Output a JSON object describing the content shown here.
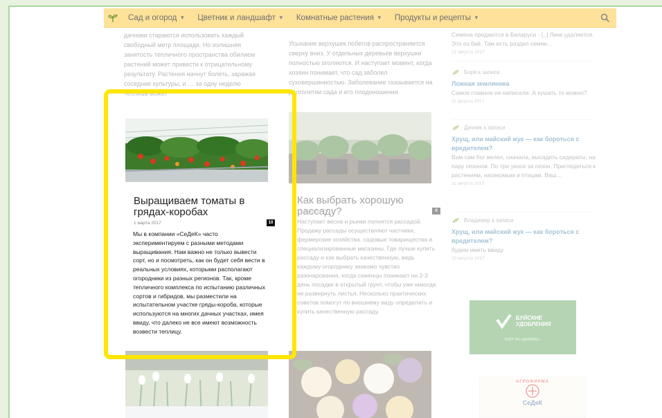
{
  "nav": {
    "items": [
      {
        "label": "Сад и огород"
      },
      {
        "label": "Цветник и ландшафт"
      },
      {
        "label": "Комнатные растения"
      },
      {
        "label": "Продукты и рецепты"
      }
    ]
  },
  "top_left": {
    "text": "дачники стараются использовать каждый свободный метр площади. Но излишняя занятость тепличного пространства обилием растений может привести к отрицательному результату. Растения начнут болеть, заражая соседние культуры, и … за одну неделю теплица может"
  },
  "top_mid": {
    "text": "Усыхание верхушек побегов распространяется сверху вниз. У отдельных деревьев верхушки полностью оголяются. И наступает момент, когда хозяин понимает, что сад заболел суховершинностью. Заболевание сказывается на долголетии сада и его плодоношении."
  },
  "post1": {
    "title": "Выращиваем томаты в грядах-коробах",
    "date": "1 марта 2017",
    "comments": "10",
    "text": "Мы в компании «СеДеК» часто экспериментируем с разными методами выращивания. Нам важно не только вывести сорт, но и посмотреть, как он будет себя вести в реальных условиях, которыми располагают огородники из разных регионов. Так, кроме тепличного комплекса по испытанию различных сортов и гибридов, мы разместили на испытательном участке гряды-короба, которые используются на многих дачных участках, имея ввиду, что далеко не все имеют возможность возвести теплицу."
  },
  "post2": {
    "title": "Как выбрать хорошую рассаду?",
    "date": "28 февраля 2017",
    "comments": "0",
    "text": "Наступает весна и рынки полнятся рассадой. Продажу рассады осуществляют частники, фермерские хозяйства, садовые товарищества и специализированные магазины. Где лучше купить рассаду и как выбрать качественную, ведь каждому огороднику знакомо чувство разочарования, когда саженцы поникают на 2-3 день посадки в открытый грунт, чтобы уже никогда не развернуть листья. Несколько практических советов помогут по внешнему виду определить и купить качественную рассаду."
  },
  "sidebar": {
    "top": {
      "body": "Семена продаются в Беларуси - [..] Линк удаляется. Это оз.бай. Там есть раздел семян…",
      "date": "12 августа 2017"
    },
    "comments": [
      {
        "author": "Боря к записи",
        "title": "Ложная земляника",
        "body": "Самое главное не написали. А кушать то можно?",
        "date": "11 августа 2017"
      },
      {
        "author": "Дачник к записи",
        "title": "Хрущ, или майский жук — как бороться с вредителем?",
        "body": "Вам сам бог велел, сначала, высадить сидераты, на пару сезонов. По три укоса за сезон. Приглядеться к растениям, насекомым и птицам. Ваш…",
        "date": "11 августа 2017"
      },
      {
        "author": "Владимир к записи",
        "title": "Хрущ, или майский жук — как бороться с вредителем?",
        "body": "будем иметь ввиду",
        "date": "10 августа 2017"
      }
    ],
    "banner1": {
      "line1": "БУЙСКИЕ",
      "line2": "УДОБРЕНИЯ",
      "caption": "БЛОГ НА «ДАЧНИКЕ»"
    },
    "banner2": {
      "brand": "СеДеК",
      "arc": "АГРОФИРМА"
    }
  },
  "colors": {
    "nav_bg": "#ffe299",
    "highlight": "#ffe600",
    "link": "#2a6fa0"
  }
}
